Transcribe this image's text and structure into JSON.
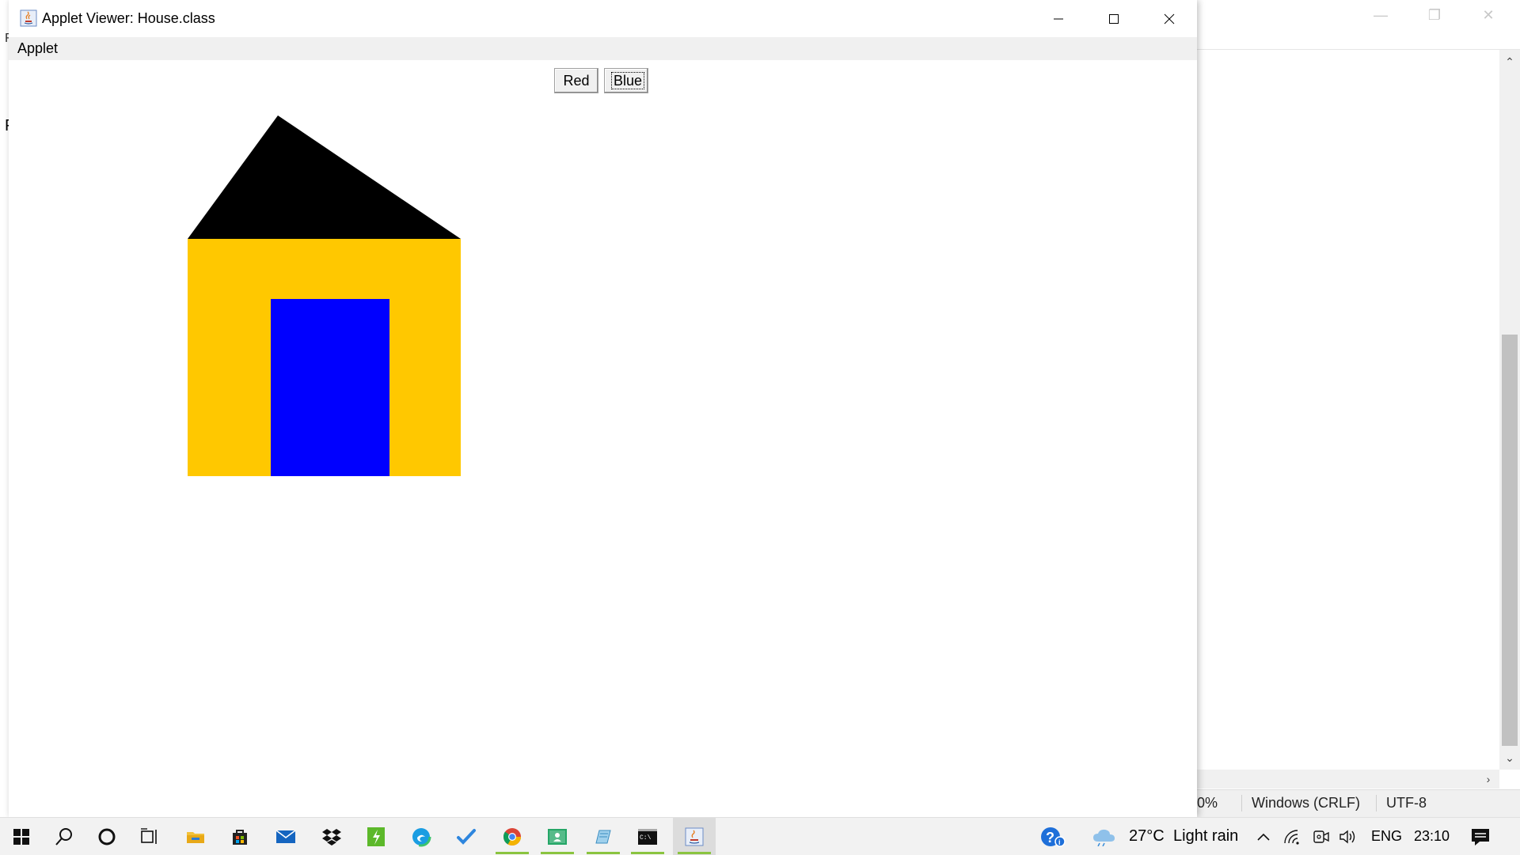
{
  "background_window": {
    "partial_char_1": "P",
    "partial_char_2": "F",
    "status": {
      "zoom": "0%",
      "line_ending": "Windows (CRLF)",
      "encoding": "UTF-8"
    }
  },
  "applet_window": {
    "title": "Applet Viewer: House.class",
    "menu": [
      "Applet"
    ],
    "buttons": {
      "red_label": "Red",
      "blue_label": "Blue"
    },
    "drawing": {
      "roof_color": "#000000",
      "wall_color": "#FFC800",
      "door_color": "#0000FF"
    }
  },
  "taskbar": {
    "apps": [
      "windows-start",
      "search",
      "cortana",
      "task-view",
      "file-explorer",
      "microsoft-store",
      "mail",
      "dropbox",
      "app-green",
      "edge",
      "todo",
      "chrome",
      "classroom",
      "notepad",
      "terminal",
      "java"
    ],
    "weather": {
      "temp": "27°C",
      "condition": "Light rain"
    },
    "language": "ENG",
    "time": "23:10"
  }
}
